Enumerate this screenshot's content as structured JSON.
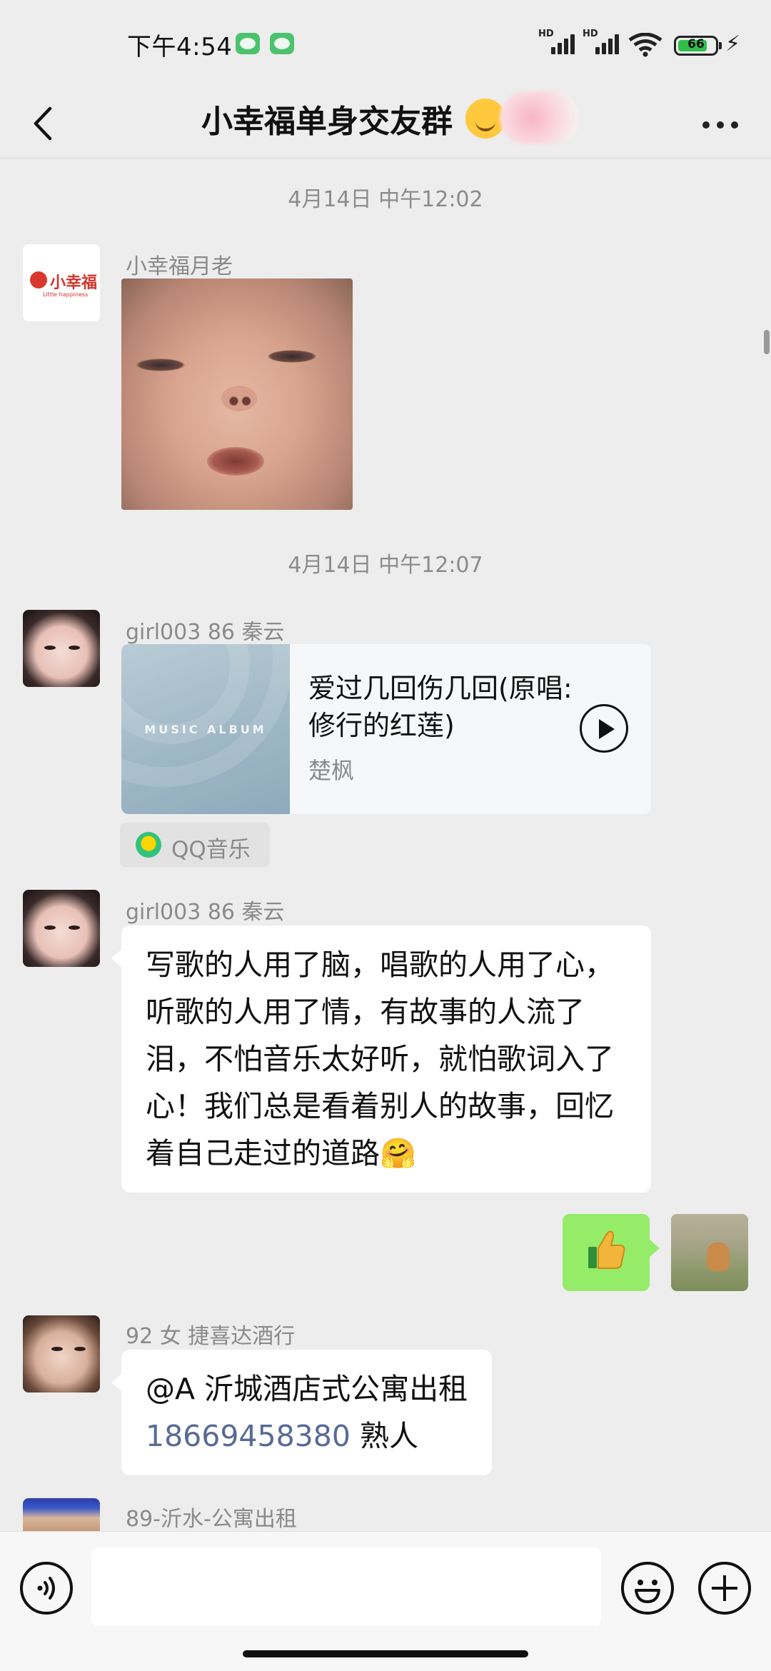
{
  "status_bar": {
    "time": "下午4:54",
    "signal_labels": [
      "HD",
      "HD"
    ],
    "battery": "66",
    "icons": [
      "wechat-icon",
      "wechat-icon",
      "signal-icon",
      "signal-icon",
      "wifi-icon",
      "battery-icon",
      "charging-icon"
    ]
  },
  "header": {
    "title": "小幸福单身交友群",
    "back_icon": "chevron-left-icon",
    "more_icon": "more-icon"
  },
  "messages": {
    "ts1": "4月14日 中午12:02",
    "m1": {
      "sender": "小幸福月老",
      "avatar_text": "小幸福",
      "avatar_sub": "Little happiness",
      "type": "image"
    },
    "ts2": "4月14日 中午12:07",
    "m2": {
      "sender": "girl003 86 秦云",
      "type": "music",
      "cover_text": "MUSIC ALBUM",
      "song_title": "爱过几回伤几回(原唱:修行的红莲)",
      "artist": "楚枫",
      "source": "QQ音乐"
    },
    "m3": {
      "sender": "girl003 86 秦云",
      "text": "写歌的人用了脑，唱歌的人用了心，听歌的人用了情，有故事的人流了泪，不怕音乐太好听，就怕歌词入了心！我们总是看着别人的故事，回忆着自己走过的道路🤗"
    },
    "m4": {
      "type": "sticker",
      "icon": "thumbs-up-icon"
    },
    "m5": {
      "sender": "92 女 捷喜达酒行",
      "line1": "@A 沂城酒店式公寓出租",
      "phone": "18669458380",
      "suffix": " 熟人"
    },
    "m6": {
      "sender": "89-沂水-公寓出租"
    }
  },
  "input_bar": {
    "value": "",
    "icons": [
      "voice-icon",
      "emoji-icon",
      "plus-icon"
    ]
  },
  "colors": {
    "background": "#ededed",
    "outgoing_bubble": "#95ec69",
    "link": "#576b95"
  }
}
